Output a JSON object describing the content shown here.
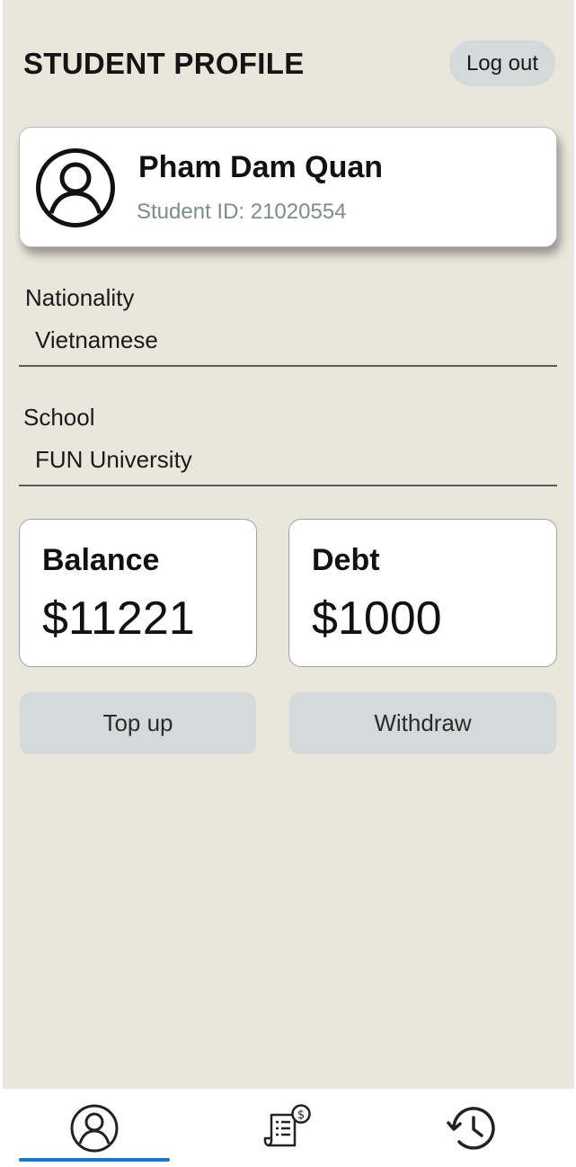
{
  "header": {
    "title": "STUDENT PROFILE",
    "logout_label": "Log out"
  },
  "profile": {
    "name": "Pham Dam Quan",
    "student_id": "Student ID: 21020554",
    "avatar_icon": "user-circle-icon"
  },
  "fields": {
    "nationality": {
      "label": "Nationality",
      "value": "Vietnamese"
    },
    "school": {
      "label": "School",
      "value": "FUN University"
    }
  },
  "stats": {
    "balance": {
      "label": "Balance",
      "value": "$11221"
    },
    "debt": {
      "label": "Debt",
      "value": "$1000"
    }
  },
  "actions": {
    "top_up_label": "Top up",
    "withdraw_label": "Withdraw"
  },
  "nav": {
    "items": [
      {
        "icon": "profile-icon",
        "active": true
      },
      {
        "icon": "bill-dollar-icon",
        "active": false
      },
      {
        "icon": "history-icon",
        "active": false
      }
    ],
    "active_color": "#1976d2"
  },
  "colors": {
    "background": "#e9e6dc",
    "button": "#d4d9da",
    "id_text": "#7d8d8a"
  }
}
